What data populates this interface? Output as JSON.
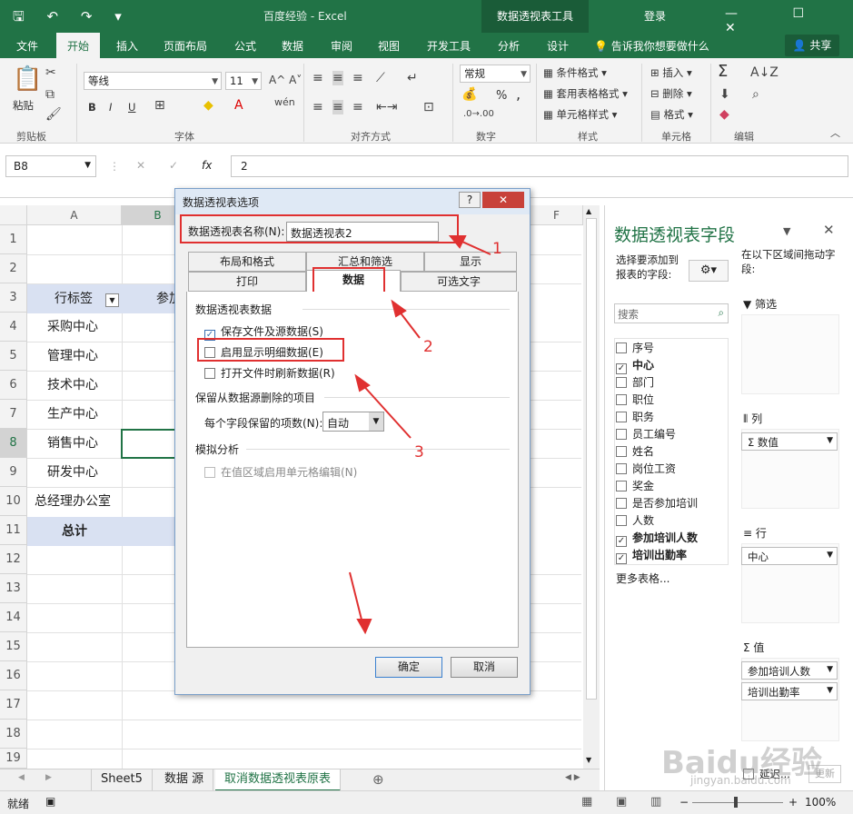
{
  "titlebar": {
    "qat": "🖫 ↶ ↷ ▾",
    "window_title": "百度经验  -  Excel",
    "context_tab": "数据透视表工具",
    "login": "登录",
    "window_controls": "— ☐ ✕"
  },
  "tabs": [
    "文件",
    "开始",
    "插入",
    "页面布局",
    "公式",
    "数据",
    "审阅",
    "视图",
    "开发工具",
    "分析",
    "设计"
  ],
  "tell_me": "告诉我你想要做什么",
  "share": "共享",
  "ribbon": {
    "paste": "粘贴",
    "clipboard": "剪贴板",
    "font_name": "等线",
    "font_size": "11",
    "font_group": "字体",
    "bold": "B",
    "italic": "I",
    "underline": "U",
    "align_group": "对齐方式",
    "number_format": "常规",
    "number_group": "数字",
    "percent": "%",
    "comma": ",",
    "cond_format": "条件格式",
    "table_format": "套用表格格式",
    "cell_style": "单元格样式",
    "styles_group": "样式",
    "insert": "插入",
    "delete": "删除",
    "format": "格式",
    "cells_group": "单元格",
    "editing_group": "编辑",
    "sum": "Σ"
  },
  "formula_bar": {
    "name_box": "B8",
    "fx": "fx",
    "value": "2",
    "cancel": "✕",
    "enter": "✓"
  },
  "sheet": {
    "columns": [
      "A",
      "B",
      "C",
      "D",
      "E",
      "F"
    ],
    "rows": [
      "1",
      "2",
      "3",
      "4",
      "5",
      "6",
      "7",
      "8",
      "9",
      "10",
      "11",
      "12",
      "13",
      "14",
      "15",
      "16",
      "17",
      "18",
      "19"
    ],
    "header_label": "行标签",
    "header_col2_partial": "参加",
    "items": [
      "采购中心",
      "管理中心",
      "技术中心",
      "生产中心",
      "销售中心",
      "研发中心",
      "总经理办公室"
    ],
    "total": "总计"
  },
  "sheet_tabs": [
    "Sheet5",
    "数据 源",
    "取消数据透视表原表"
  ],
  "status": {
    "ready": "就绪",
    "zoom": "100%"
  },
  "pane": {
    "title": "数据透视表字段",
    "subtitle": "选择要添加到报表的字段:",
    "drag_hint": "在以下区域间拖动字段:",
    "search_placeholder": "搜索",
    "fields": [
      {
        "label": "序号",
        "checked": false
      },
      {
        "label": "中心",
        "checked": true
      },
      {
        "label": "部门",
        "checked": false
      },
      {
        "label": "职位",
        "checked": false
      },
      {
        "label": "职务",
        "checked": false
      },
      {
        "label": "员工编号",
        "checked": false
      },
      {
        "label": "姓名",
        "checked": false
      },
      {
        "label": "岗位工资",
        "checked": false
      },
      {
        "label": "奖金",
        "checked": false
      },
      {
        "label": "是否参加培训",
        "checked": false
      },
      {
        "label": "人数",
        "checked": false
      },
      {
        "label": "参加培训人数",
        "checked": true
      },
      {
        "label": "培训出勤率",
        "checked": true
      }
    ],
    "more_tables": "更多表格...",
    "filter_label": "筛选",
    "columns_label": "列",
    "rows_label": "行",
    "values_label": "值",
    "columns_item": "Σ 数值",
    "rows_item": "中心",
    "values_items": [
      "参加培训人数",
      "培训出勤率"
    ],
    "defer": "延迟...",
    "update": "更新"
  },
  "dialog": {
    "title": "数据透视表选项",
    "help": "?",
    "close": "✕",
    "name_label": "数据透视表名称(N):",
    "name_value": "数据透视表2",
    "tabs_row1": [
      "布局和格式",
      "汇总和筛选",
      "显示"
    ],
    "tabs_row2": [
      "打印",
      "数据",
      "可选文字"
    ],
    "section_data": "数据透视表数据",
    "opt_save": "保存文件及源数据(S)",
    "opt_save_checked": true,
    "opt_detail": "启用显示明细数据(E)",
    "opt_detail_checked": false,
    "opt_refresh": "打开文件时刷新数据(R)",
    "opt_refresh_checked": false,
    "section_retain": "保留从数据源删除的项目",
    "retain_label": "每个字段保留的项数(N):",
    "retain_value": "自动",
    "section_whatif": "模拟分析",
    "opt_whatif": "在值区域启用单元格编辑(N)",
    "ok": "确定",
    "cancel": "取消"
  },
  "annotations": [
    "1",
    "2",
    "3"
  ],
  "watermark": "Baidu经验",
  "watermark_url": "jingyan.baidu.com"
}
